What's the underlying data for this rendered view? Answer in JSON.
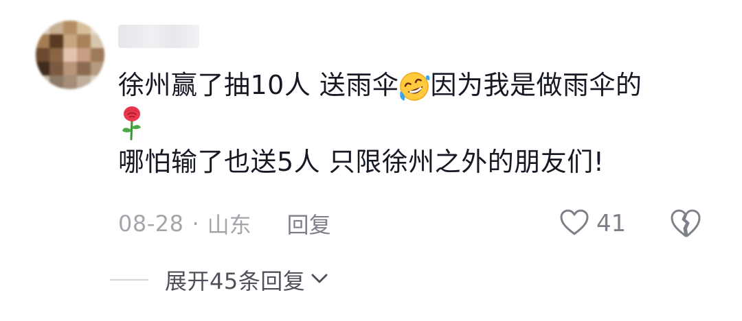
{
  "comment": {
    "author": {
      "avatar_icon": "blurred-avatar",
      "username": ""
    },
    "text": {
      "line1_before_emoji": "徐州赢了抽10人 送雨伞",
      "line1_emoji_icon": "rolling-laughing-face-emoji",
      "line1_after_emoji": "因为我是做雨伞的",
      "line2_emoji_icon": "rose-emoji",
      "line3": "哪怕输了也送5人 只限徐州之外的朋友们!"
    },
    "meta": {
      "date": "08-28",
      "separator": "·",
      "location": "山东",
      "reply_label": "回复"
    },
    "actions": {
      "like_icon": "heart-outline-icon",
      "like_count": "41",
      "dislike_icon": "broken-heart-icon"
    },
    "replies": {
      "expand_label": "展开45条回复",
      "expand_icon": "chevron-down-icon"
    }
  },
  "colors": {
    "text_primary": "#161823",
    "text_secondary": "#a3a5ab",
    "text_action": "#7d8088",
    "divider": "#d3d5d9"
  }
}
